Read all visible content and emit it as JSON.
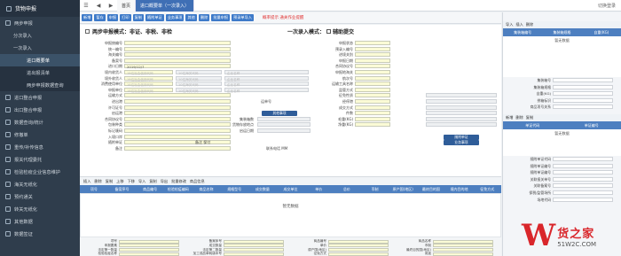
{
  "sidebar": {
    "title": "货物申报",
    "items": [
      {
        "label": "两步申报",
        "level": 1
      },
      {
        "label": "分次录入",
        "level": 2
      },
      {
        "label": "一次录入",
        "level": 2
      },
      {
        "label": "进口概要单",
        "level": 3,
        "active": true
      },
      {
        "label": "进出报清单",
        "level": 3
      },
      {
        "label": "两步申报数据查询",
        "level": 3
      },
      {
        "label": "进口整合申报",
        "level": 1
      },
      {
        "label": "出口整合申报",
        "level": 1
      },
      {
        "label": "数据查询/统计",
        "level": 1
      },
      {
        "label": "修撤单",
        "level": 1
      },
      {
        "label": "重传/补传信息",
        "level": 1
      },
      {
        "label": "报关代理委托",
        "level": 1
      },
      {
        "label": "检验检疫企业信息维护",
        "level": 1
      },
      {
        "label": "海关无纸化",
        "level": 1
      },
      {
        "label": "预约通关",
        "level": 1
      },
      {
        "label": "转关无纸化",
        "level": 1
      },
      {
        "label": "其他数据",
        "level": 1
      },
      {
        "label": "数据签证",
        "level": 1
      }
    ]
  },
  "topbar": {
    "home_tab": "首页",
    "current_tab": "进口概要单（一次录入）",
    "right_label": "切换登录"
  },
  "toolbar": {
    "buttons": [
      "新增",
      "暂存",
      "申报",
      "打印",
      "复制",
      "随附单证",
      "业务事项",
      "其他",
      "删除",
      "批量申报",
      "预录单导入"
    ],
    "notice": "概率提示 通关作业提醒"
  },
  "right_button": "申报",
  "form": {
    "mode_title": "两步申报模式：非证、非税、非检",
    "mode_right": "一次录入模式：",
    "mode_option": "辅助提交",
    "left_labels": [
      "申报统编号",
      "统一编号",
      "海关编号",
      "备案号",
      "进口日期",
      "境内收货人",
      "境外收货人",
      "消费使用单位",
      "申报单位",
      "运输方式",
      "进出港",
      "许可证号",
      "启运港",
      "合同协议号",
      "包装种类",
      "标记唛码",
      "入境口岸",
      "随附单证",
      "备注"
    ],
    "date_value": "2019/12/7",
    "mid_labels": [
      "申报状态",
      "预录入编号",
      "进境关别",
      "申报日期",
      "合同协议号",
      "申报地海关",
      "航次号",
      "运输工具名称",
      "监管方式",
      "征免性质",
      "经停港",
      "成交方式",
      "件数",
      "毛重(KG)",
      "净重(KG)"
    ],
    "hint_text": "18位社会信用代码",
    "hint_text2": "10位海关代码",
    "hint_text3": "企业名称",
    "fill_row_label": "运单号",
    "mini_labels": [
      "集装箱数",
      "货物存放地点",
      "启运日期"
    ],
    "blue_buttons": [
      "其他事项",
      "随附单证",
      "业务事项",
      "其他事项确认"
    ],
    "notes": [
      "备注 保付",
      "报关人员"
    ],
    "contact_label": "联系电话 MM"
  },
  "grid": {
    "toolbar": [
      "插入",
      "删除",
      "复制",
      "上移",
      "下移",
      "导入",
      "复制",
      "导出",
      "批量修改",
      "商品信息"
    ],
    "headers": [
      "项号",
      "备案序号",
      "商品编号",
      "检验检疫编码",
      "商品名称",
      "规格型号",
      "成交数量",
      "成交单位",
      "单价",
      "总价",
      "币制",
      "原产国(地区)",
      "最终目的国",
      "境内目的地",
      "征免方式"
    ],
    "empty_text": "暂无数据"
  },
  "bottom": {
    "labels": [
      "项号",
      "备案序号",
      "商品编号",
      "商品名称",
      "申报要素",
      "成交数量",
      "单价",
      "币制",
      "法定第一数量",
      "法定第二数量",
      "原产国(地区)",
      "最终目的国(地区)",
      "检验检疫名称",
      "加工成品单耗版本号",
      "征免方式",
      "用途"
    ]
  },
  "right_panel": {
    "toolbar": [
      "导入",
      "插入",
      "删除"
    ],
    "headers": [
      "集装箱编号",
      "集装箱规格",
      "自重(KG)"
    ],
    "empty_text": "暂无数据",
    "labels": [
      "集装箱号",
      "集装箱规格",
      "自重(KG)",
      "拼箱标识",
      "商品项号关系"
    ],
    "doc_toolbar": [
      "新增",
      "删除",
      "复制"
    ],
    "doc_headers": [
      "单证代码",
      "单证编号"
    ],
    "doc_empty": "暂无数据",
    "doc_labels": [
      "随附单证代码",
      "随附单证编号",
      "随附单证编号",
      "关联报关单号",
      "关联备案号",
      "保税/监管场所",
      "场地代码"
    ]
  },
  "watermark": {
    "logo": "W",
    "cn": "货之家",
    "url": "51W2C.COM"
  },
  "colors": {
    "sidebar": "#2f3d4c",
    "accent": "#3f6fb5",
    "input_yellow": "#fbfbd6",
    "notice_red": "#e03030"
  }
}
